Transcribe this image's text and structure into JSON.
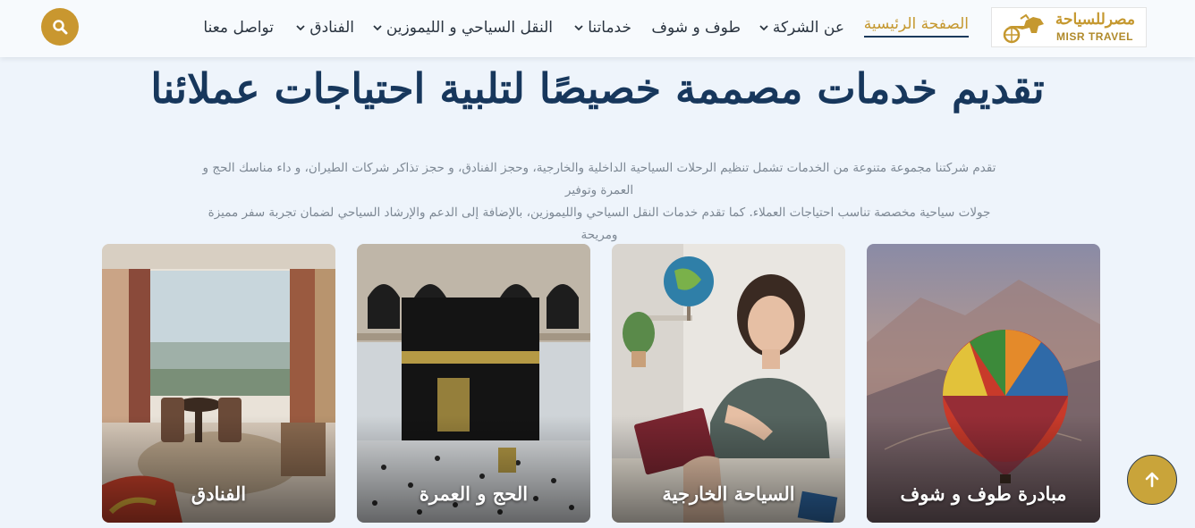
{
  "header": {
    "logo": {
      "arabic": "مصرللسياحة",
      "english": "MISR TRAVEL"
    },
    "nav": [
      {
        "label": "الصفحة الرئيسية",
        "active": true,
        "dropdown": false
      },
      {
        "label": "عن الشركة",
        "active": false,
        "dropdown": true
      },
      {
        "label": "طوف و شوف",
        "active": false,
        "dropdown": false
      },
      {
        "label": "خدماتنا",
        "active": false,
        "dropdown": true
      },
      {
        "label": "النقل السياحي و الليموزين",
        "active": false,
        "dropdown": true
      },
      {
        "label": "الفنادق",
        "active": false,
        "dropdown": true
      },
      {
        "label": "تواصل معنا",
        "active": false,
        "dropdown": false
      }
    ],
    "search_icon": "search-icon"
  },
  "main": {
    "title": "تقديم خدمات مصممة خصيصًا لتلبية احتياجات عملائنا",
    "description_line1": "تقدم شركتنا مجموعة متنوعة من الخدمات تشمل تنظيم الرحلات السياحية الداخلية والخارجية، وحجز الفنادق، و حجز تذاكر شركات الطيران، و داء مناسك الحج و العمرة وتوفير",
    "description_line2": "جولات سياحية مخصصة تناسب احتياجات العملاء. كما تقدم خدمات النقل السياحي والليموزين، بالإضافة إلى الدعم والإرشاد السياحي لضمان تجربة سفر مميزة ومريحة"
  },
  "cards": [
    {
      "label": "مبادرة طوف و شوف",
      "image": "hot-air-balloon"
    },
    {
      "label": "السياحة الخارجية",
      "image": "travel-agent-passport"
    },
    {
      "label": "الحج و العمرة",
      "image": "kaaba-mecca"
    },
    {
      "label": "الفنادق",
      "image": "hotel-room"
    }
  ],
  "colors": {
    "accent_gold": "#c9972f",
    "title_navy": "#17375c",
    "background": "#eef4fb"
  },
  "scroll_top_icon": "arrow-up-icon"
}
